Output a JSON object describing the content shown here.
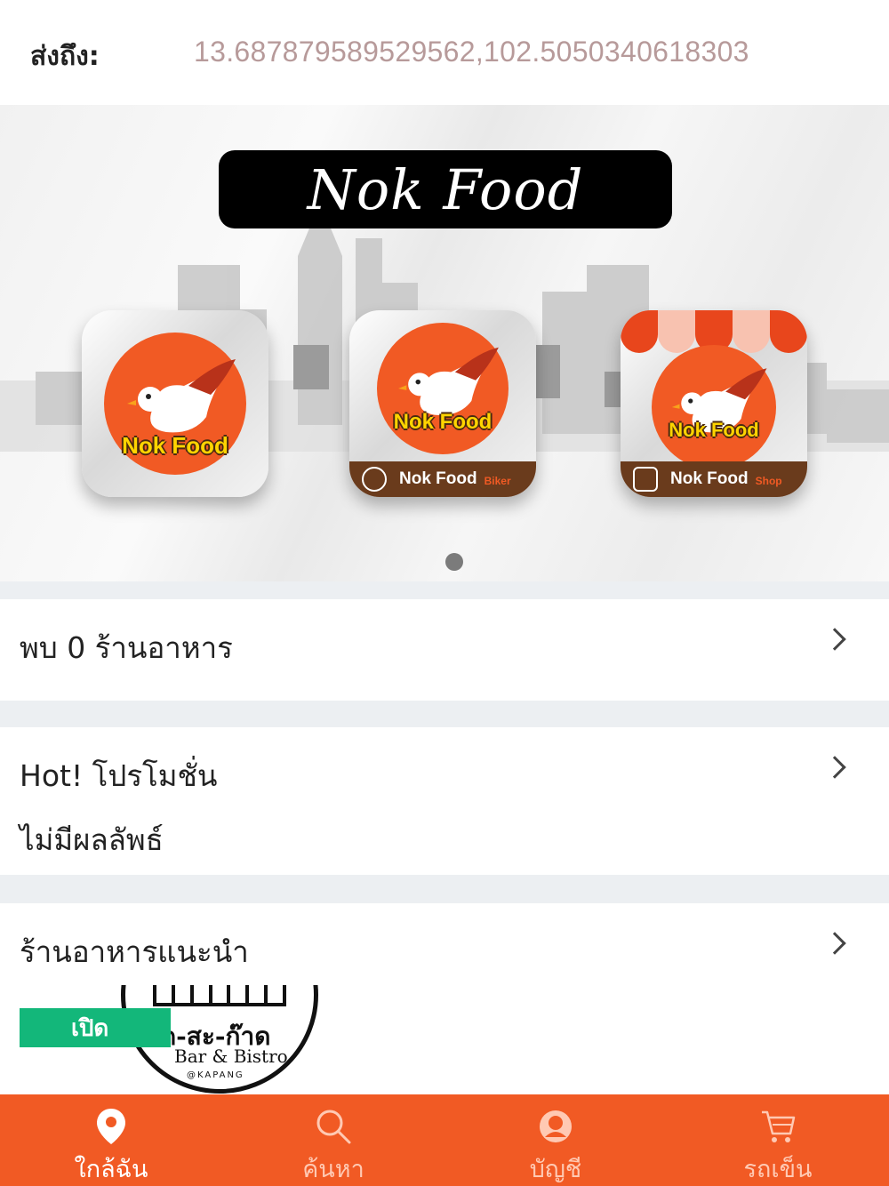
{
  "header": {
    "deliver_to_label": "ส่งถึง:",
    "coordinates": "13.687879589529562,102.5050340618303"
  },
  "banner": {
    "title": "Nok Food",
    "apps": [
      {
        "logo_text": "Nok Food",
        "strip_label": "",
        "strip_sub": ""
      },
      {
        "logo_text": "Nok Food",
        "strip_label": "Nok Food",
        "strip_sub": "Biker"
      },
      {
        "logo_text": "Nok Food",
        "strip_label": "Nok Food",
        "strip_sub": "Shop"
      }
    ]
  },
  "sections": {
    "found": {
      "title": "พบ 0 ร้านอาหาร"
    },
    "promo": {
      "title": "Hot! โปรโมชั่น",
      "empty_text": "ไม่มีผลลัพธ์"
    },
    "recommended": {
      "title": "ร้านอาหารแนะนำ",
      "restaurant": {
        "status_badge": "เปิด",
        "logo_name": "ด-สะ-ก๊าด",
        "logo_sub": "Bar & Bistro",
        "logo_sub2": "@KAPANG"
      }
    }
  },
  "tabbar": {
    "tabs": [
      {
        "label": "ใกล้ฉัน",
        "icon": "location-pin-icon",
        "active": true
      },
      {
        "label": "ค้นหา",
        "icon": "search-icon",
        "active": false
      },
      {
        "label": "บัญชี",
        "icon": "account-icon",
        "active": false
      },
      {
        "label": "รถเข็น",
        "icon": "cart-icon",
        "active": false
      }
    ]
  },
  "colors": {
    "accent": "#f15a24",
    "open_badge": "#13b77a",
    "coords_text": "#b79a9a",
    "separator": "#eceff2"
  }
}
